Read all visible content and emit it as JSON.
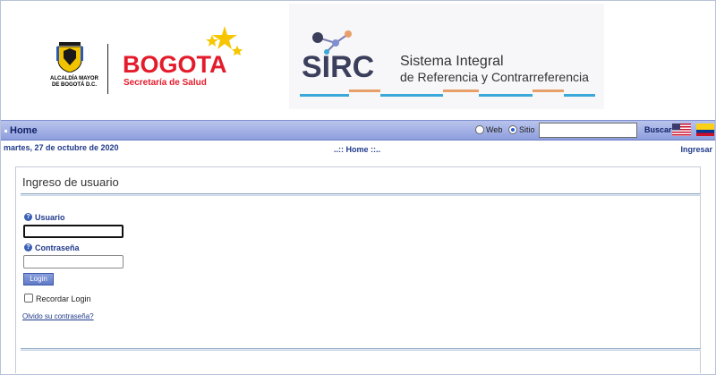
{
  "header": {
    "alcaldia_line1": "ALCALDÍA MAYOR",
    "alcaldia_line2": "DE BOGOTÁ D.C.",
    "bogota_logo_text": "BOGOTA",
    "secretaria": "Secretaría de Salud",
    "sirc_logo_text": "SIRC",
    "sirc_title_line1": "Sistema Integral",
    "sirc_title_line2": "de Referencia y Contrarreferencia",
    "brand_red": "#e41b2b",
    "sirc_colors": [
      "#3b3f5c",
      "#e8a06b",
      "#3aa8d8",
      "#7f8fd0"
    ]
  },
  "navbar": {
    "home_label": "Home",
    "radio_web_label": "Web",
    "radio_sitio_label": "Sitio",
    "selected_scope": "Sitio",
    "search_value": "",
    "buscar_label": "Buscar",
    "flags": [
      "flag-us-icon",
      "flag-colombia-icon"
    ]
  },
  "subbar": {
    "date": "martes, 27 de octubre de 2020",
    "breadcrumb": "..:: Home ::..",
    "ingresar": "Ingresar"
  },
  "login": {
    "title": "Ingreso de usuario",
    "usuario_label": "Usuario",
    "usuario_value": "",
    "contrasena_label": "Contraseña",
    "contrasena_value": "",
    "login_button": "Login",
    "remember_label": "Recordar Login",
    "remember_checked": false,
    "forgot_link": "Olvido su contraseña?",
    "help_icon_glyph": "?"
  }
}
